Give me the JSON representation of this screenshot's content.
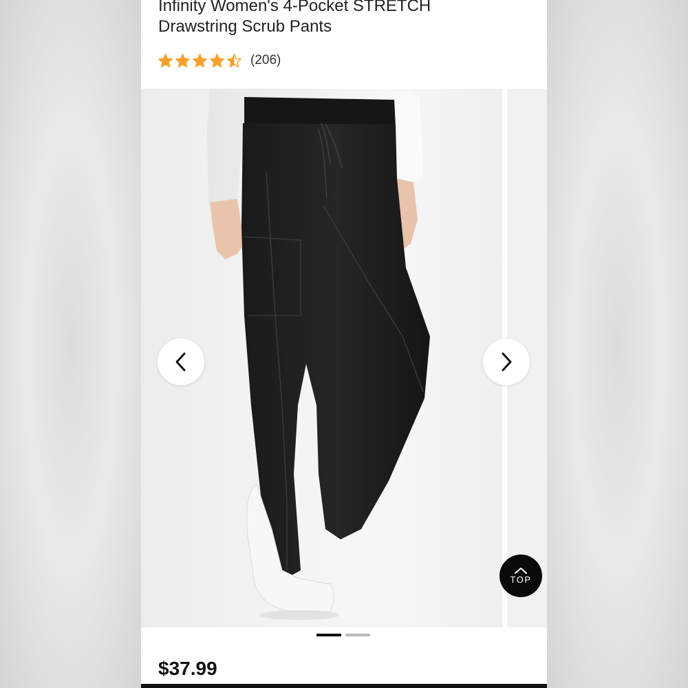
{
  "product": {
    "title_line1": "Infinity Women's 4-Pocket STRETCH",
    "title_line2": "Drawstring Scrub Pants",
    "rating_value": 4.5,
    "rating_max": 5,
    "review_count": "(206)",
    "price": "$37.99",
    "image_icon": "product-photo-black-scrub-pants"
  },
  "carousel": {
    "slide_count": 2,
    "active_index": 0,
    "prev_icon": "chevron-left-icon",
    "next_icon": "chevron-right-icon"
  },
  "top_button": {
    "label": "TOP",
    "icon": "chevron-up-icon"
  },
  "colors": {
    "star": "#F5A12B",
    "text": "#222222",
    "top_button_bg": "#0A0A0A",
    "active_dot": "#111111",
    "inactive_dot": "#BCBCBC"
  }
}
